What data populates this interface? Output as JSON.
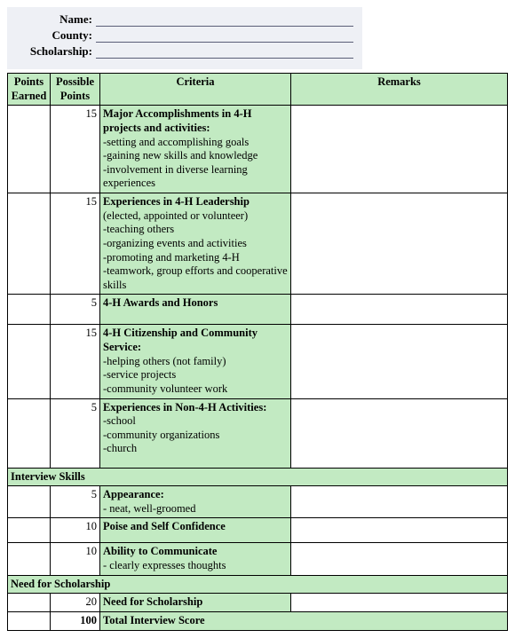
{
  "header": {
    "name_label": "Name:",
    "county_label": "County:",
    "scholarship_label": "Scholarship:"
  },
  "columns": {
    "points_earned": "Points Earned",
    "possible_points": "Possible Points",
    "criteria": "Criteria",
    "remarks": "Remarks"
  },
  "rows": [
    {
      "possible": "15",
      "title": "Major Accomplishments in 4-H projects and activities:",
      "subs": [
        "-setting and accomplishing goals",
        "-gaining new skills and knowledge",
        "-involvement in diverse learning experiences"
      ]
    },
    {
      "possible": "15",
      "title": "Experiences in 4-H Leadership",
      "title2": "(elected, appointed or volunteer)",
      "subs": [
        "-teaching others",
        "-organizing events and activities",
        "-promoting and marketing 4-H",
        "-teamwork, group efforts and cooperative skills"
      ]
    },
    {
      "possible": "5",
      "title": "4-H Awards and Honors",
      "subs": []
    },
    {
      "possible": "15",
      "title": "4-H Citizenship and Community Service:",
      "subs": [
        "-helping others (not family)",
        "-service projects",
        "-community volunteer work"
      ]
    },
    {
      "possible": "5",
      "title": "Experiences in Non-4-H Activities:",
      "subs": [
        "-school",
        "-community organizations",
        "-church"
      ]
    }
  ],
  "section_interview": "Interview Skills",
  "interview_rows": [
    {
      "possible": "5",
      "title": "Appearance:",
      "subs": [
        "- neat, well-groomed"
      ]
    },
    {
      "possible": "10",
      "title": "Poise and Self Confidence",
      "subs": []
    },
    {
      "possible": "10",
      "title": "Ability to Communicate",
      "subs": [
        "- clearly expresses thoughts"
      ]
    }
  ],
  "section_need": "Need for Scholarship",
  "need_row": {
    "possible": "20",
    "title": "Need for Scholarship"
  },
  "total": {
    "points": "100",
    "label": "Total Interview Score"
  }
}
